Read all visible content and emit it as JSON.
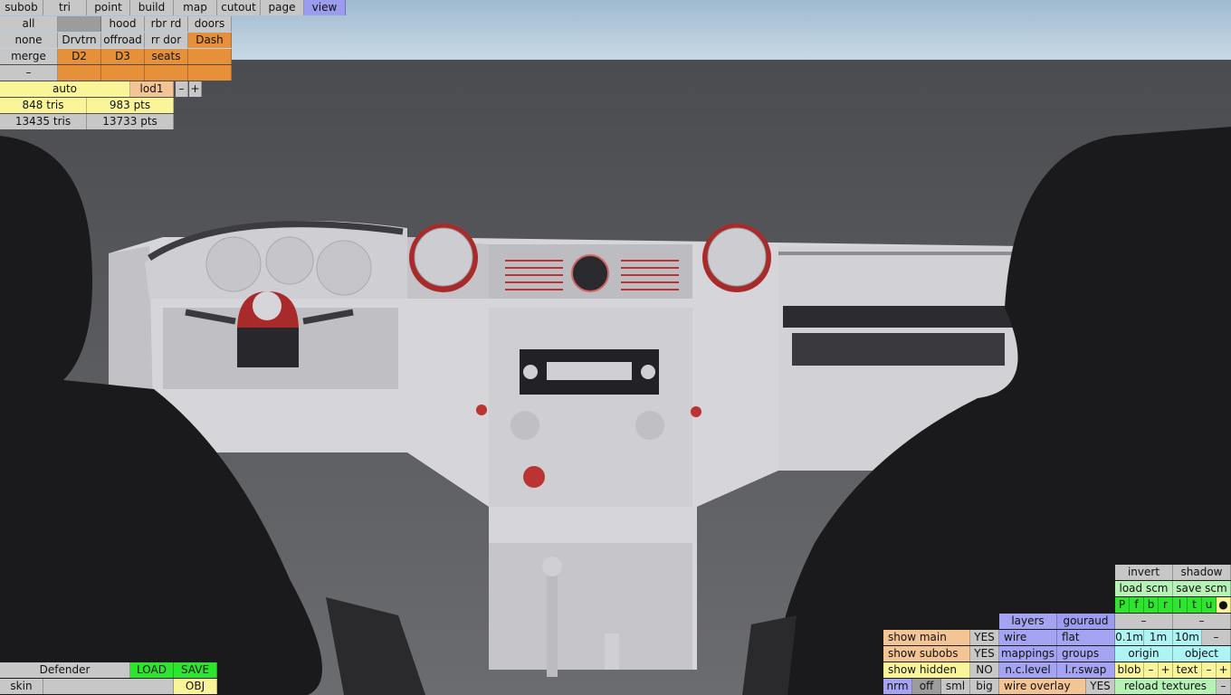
{
  "top_menu": [
    "subob",
    "tri",
    "point",
    "build",
    "map",
    "cutout",
    "page",
    "view"
  ],
  "sel_grid": {
    "r1": [
      "all",
      "",
      "hood",
      "rbr rd",
      "doors"
    ],
    "r2": [
      "none",
      "Drvtrn",
      "offroad",
      "rr dor",
      "Dash"
    ],
    "r3": [
      "merge",
      "D2",
      "D3",
      "seats",
      ""
    ],
    "r4": [
      "–",
      "",
      "",
      "",
      ""
    ]
  },
  "lod": {
    "auto": "auto",
    "name": "lod1",
    "minus": "–",
    "plus": "+"
  },
  "stats": {
    "sel_tris": "848 tris",
    "sel_pts": "983 pts",
    "total_tris": "13435 tris",
    "total_pts": "13733 pts"
  },
  "bottom_left": {
    "name": "Defender",
    "load": "LOAD",
    "save": "SAVE",
    "skin": "skin",
    "skin_value": "",
    "obj": "OBJ"
  },
  "right": {
    "invert": "invert",
    "shadow": "shadow",
    "load_scm": "load scm",
    "save_scm": "save scm",
    "views": [
      "P",
      "f",
      "b",
      "r",
      "l",
      "t",
      "u",
      "●"
    ],
    "dash1": "–",
    "dash2": "–",
    "layers": "layers",
    "gouraud": "gouraud",
    "wire": "wire",
    "flat": "flat",
    "scale": [
      "0.1m",
      "1m",
      "10m",
      "–"
    ],
    "show_main": "show main",
    "show_main_v": "YES",
    "mappings": "mappings",
    "groups": "groups",
    "origin": "origin",
    "object": "object",
    "show_subobs": "show subobs",
    "show_subobs_v": "YES",
    "show_hidden": "show hidden",
    "show_hidden_v": "NO",
    "nc_level": "n.c.level",
    "lr_swap": "l.r.swap",
    "blob": "blob",
    "text": "text",
    "minus": "–",
    "plus": "+",
    "nrm": "nrm",
    "off": "off",
    "sml": "sml",
    "big": "big",
    "wire_overlay": "wire overlay",
    "wire_overlay_v": "YES",
    "reload": "reload textures"
  },
  "colors": {
    "sky": "#a9c3d8",
    "floor": "#5f6063",
    "dash": "#d9d9dd",
    "accent": "#b02a2a",
    "seat": "#1b1b1b"
  }
}
